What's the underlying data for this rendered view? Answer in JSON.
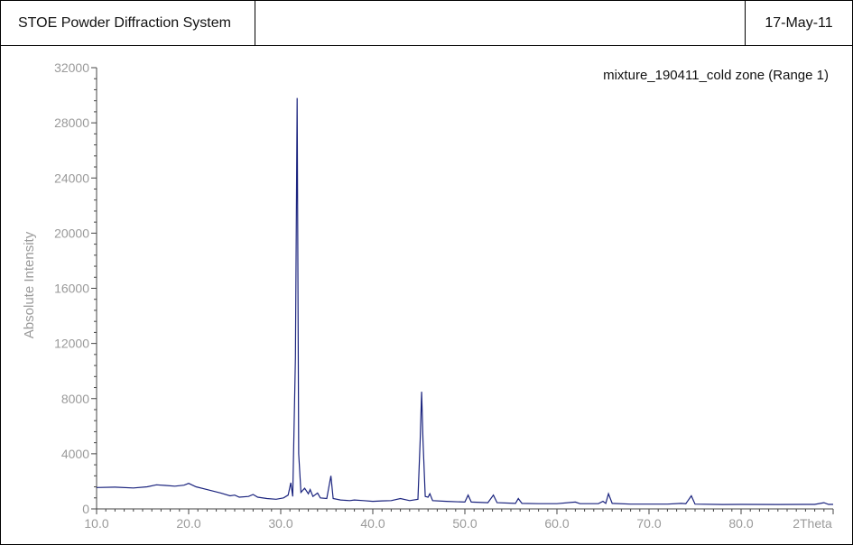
{
  "header": {
    "title": "STOE Powder Diffraction System",
    "middle": "",
    "date": "17-May-11"
  },
  "colors": {
    "trace": "#1a237e",
    "axis": "#444444",
    "label": "#9a9a9a"
  },
  "chart_data": {
    "type": "line",
    "title": "mixture_190411_cold zone (Range 1)",
    "xlabel": "2Theta",
    "ylabel": "Absolute Intensity",
    "xlim": [
      10.0,
      90.0
    ],
    "ylim": [
      0,
      32000
    ],
    "x_ticks": [
      10.0,
      20.0,
      30.0,
      40.0,
      50.0,
      60.0,
      70.0,
      80.0
    ],
    "x_tick_labels": [
      "10.0",
      "20.0",
      "30.0",
      "40.0",
      "50.0",
      "60.0",
      "70.0",
      "80.0"
    ],
    "y_ticks": [
      0,
      4000,
      8000,
      12000,
      16000,
      20000,
      24000,
      28000,
      32000
    ],
    "y_tick_labels": [
      "0",
      "4000",
      "8000",
      "12000",
      "16000",
      "20000",
      "24000",
      "28000",
      "32000"
    ],
    "grid": false,
    "legend_position": "top-right",
    "series": [
      {
        "name": "mixture_190411_cold zone (Range 1)",
        "points": [
          [
            10.0,
            1550
          ],
          [
            12.0,
            1580
          ],
          [
            14.0,
            1520
          ],
          [
            15.5,
            1600
          ],
          [
            16.5,
            1750
          ],
          [
            17.5,
            1700
          ],
          [
            18.5,
            1650
          ],
          [
            19.5,
            1720
          ],
          [
            20.0,
            1850
          ],
          [
            20.8,
            1600
          ],
          [
            22.0,
            1400
          ],
          [
            23.5,
            1150
          ],
          [
            24.5,
            950
          ],
          [
            25.0,
            1000
          ],
          [
            25.5,
            850
          ],
          [
            26.5,
            900
          ],
          [
            27.0,
            1050
          ],
          [
            27.5,
            850
          ],
          [
            28.5,
            750
          ],
          [
            29.5,
            700
          ],
          [
            30.3,
            800
          ],
          [
            30.8,
            1000
          ],
          [
            31.1,
            1900
          ],
          [
            31.3,
            900
          ],
          [
            31.6,
            11000
          ],
          [
            31.78,
            29800
          ],
          [
            31.95,
            4000
          ],
          [
            32.2,
            1200
          ],
          [
            32.6,
            1500
          ],
          [
            33.0,
            1100
          ],
          [
            33.2,
            1400
          ],
          [
            33.5,
            900
          ],
          [
            34.0,
            1150
          ],
          [
            34.3,
            800
          ],
          [
            35.0,
            750
          ],
          [
            35.45,
            2400
          ],
          [
            35.7,
            750
          ],
          [
            36.5,
            650
          ],
          [
            37.5,
            600
          ],
          [
            38.0,
            650
          ],
          [
            39.0,
            600
          ],
          [
            40.0,
            550
          ],
          [
            41.0,
            580
          ],
          [
            42.0,
            600
          ],
          [
            43.0,
            750
          ],
          [
            44.0,
            600
          ],
          [
            44.9,
            700
          ],
          [
            45.15,
            5000
          ],
          [
            45.3,
            8500
          ],
          [
            45.45,
            5000
          ],
          [
            45.7,
            900
          ],
          [
            46.0,
            850
          ],
          [
            46.2,
            1100
          ],
          [
            46.5,
            600
          ],
          [
            48.0,
            550
          ],
          [
            50.0,
            500
          ],
          [
            50.35,
            1000
          ],
          [
            50.7,
            500
          ],
          [
            52.5,
            450
          ],
          [
            53.1,
            1000
          ],
          [
            53.5,
            450
          ],
          [
            55.5,
            400
          ],
          [
            55.8,
            750
          ],
          [
            56.2,
            400
          ],
          [
            58.0,
            380
          ],
          [
            60.0,
            380
          ],
          [
            62.0,
            500
          ],
          [
            62.5,
            380
          ],
          [
            64.5,
            380
          ],
          [
            65.0,
            550
          ],
          [
            65.3,
            400
          ],
          [
            65.6,
            1100
          ],
          [
            66.0,
            400
          ],
          [
            68.0,
            350
          ],
          [
            70.0,
            350
          ],
          [
            72.0,
            350
          ],
          [
            73.5,
            400
          ],
          [
            74.0,
            380
          ],
          [
            74.6,
            950
          ],
          [
            75.0,
            350
          ],
          [
            78.0,
            320
          ],
          [
            80.0,
            330
          ],
          [
            84.0,
            320
          ],
          [
            88.0,
            330
          ],
          [
            89.0,
            450
          ],
          [
            89.5,
            330
          ],
          [
            90.0,
            330
          ]
        ]
      }
    ]
  }
}
